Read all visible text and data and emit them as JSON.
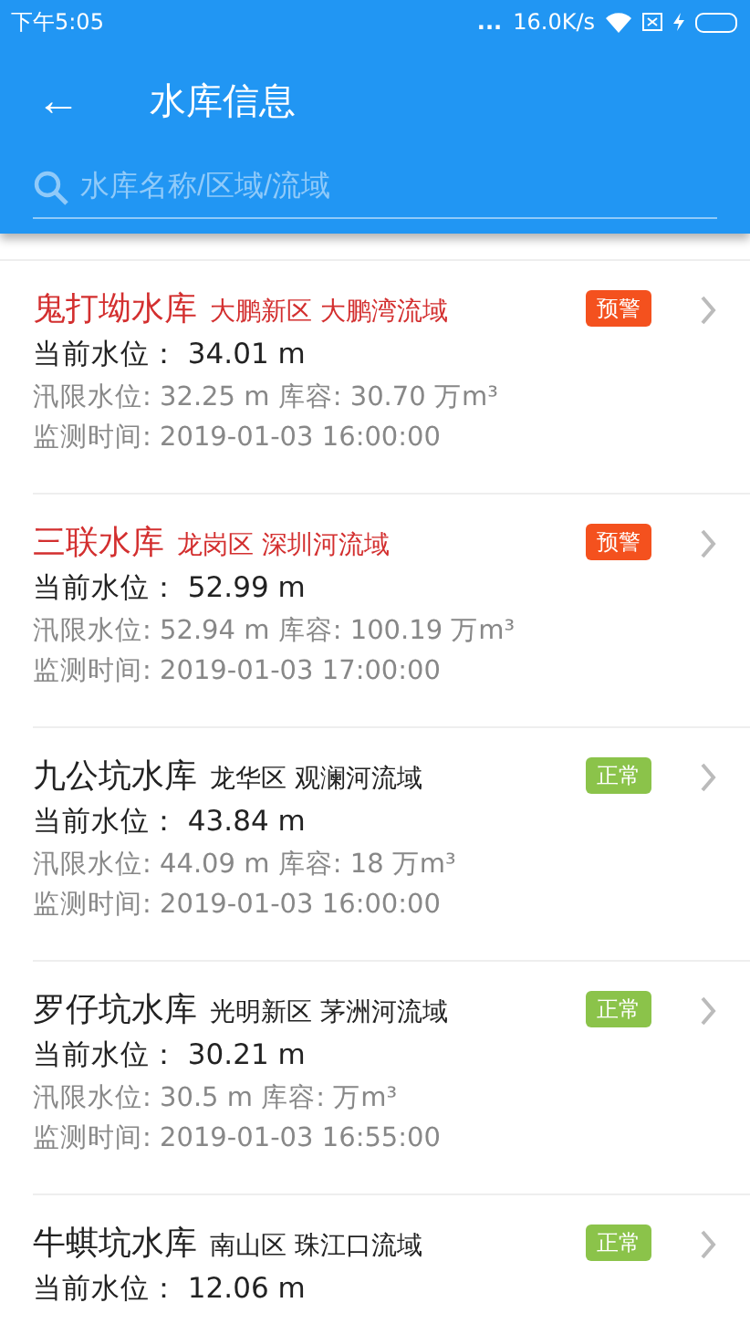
{
  "status_bar": {
    "time": "下午5:05",
    "dots": "...",
    "speed": "16.0K/s"
  },
  "app_bar": {
    "back": "←",
    "title": "水库信息"
  },
  "search": {
    "placeholder": "水库名称/区域/流域"
  },
  "reservoirs": [
    {
      "name": "鬼打坳水库",
      "area": "大鹏新区 大鹏湾流域",
      "status": {
        "kind": "warning",
        "label": "预警"
      },
      "current": "当前水位：  34.01 m",
      "limit": "汛限水位: 32.25 m 库容: 30.70 万m³",
      "time": "监测时间: 2019-01-03 16:00:00"
    },
    {
      "name": "三联水库",
      "area": "龙岗区 深圳河流域",
      "status": {
        "kind": "warning",
        "label": "预警"
      },
      "current": "当前水位：  52.99 m",
      "limit": "汛限水位: 52.94 m 库容: 100.19 万m³",
      "time": "监测时间: 2019-01-03 17:00:00"
    },
    {
      "name": "九公坑水库",
      "area": "龙华区 观澜河流域",
      "status": {
        "kind": "normal",
        "label": "正常"
      },
      "current": "当前水位：  43.84 m",
      "limit": "汛限水位: 44.09 m 库容: 18 万m³",
      "time": "监测时间: 2019-01-03 16:00:00"
    },
    {
      "name": "罗仔坑水库",
      "area": "光明新区 茅洲河流域",
      "status": {
        "kind": "normal",
        "label": "正常"
      },
      "current": "当前水位：  30.21 m",
      "limit": "汛限水位: 30.5 m 库容:  万m³",
      "time": "监测时间: 2019-01-03 16:55:00"
    },
    {
      "name": "牛蜞坑水库",
      "area": "南山区 珠江口流域",
      "status": {
        "kind": "normal",
        "label": "正常"
      },
      "current": "当前水位：  12.06 m"
    }
  ]
}
